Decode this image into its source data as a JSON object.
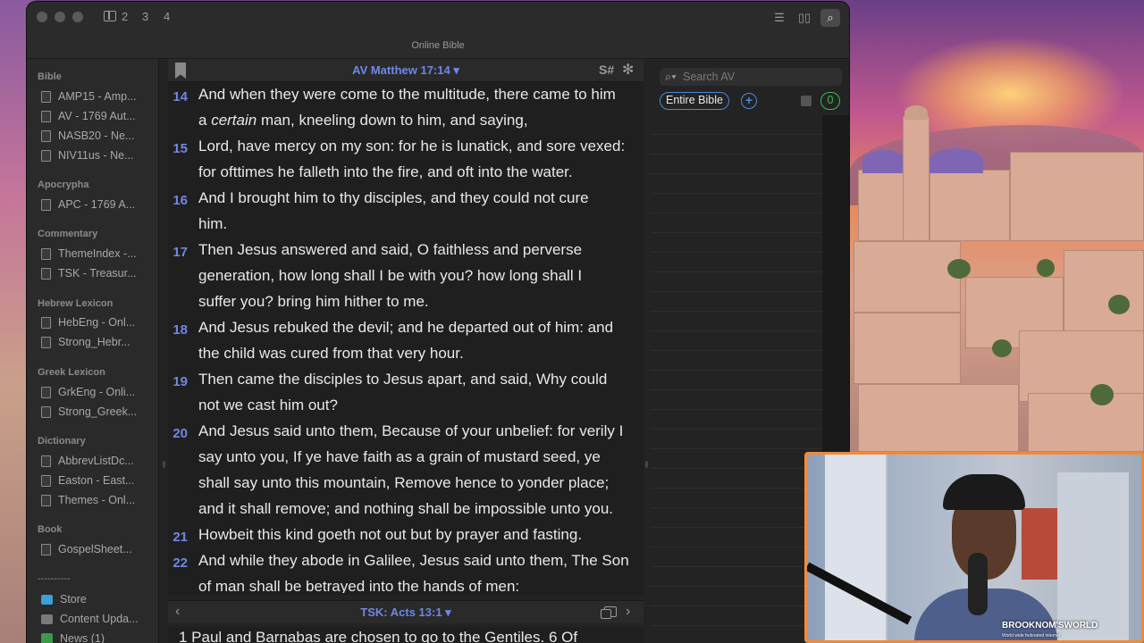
{
  "window": {
    "title": "Online Bible",
    "pane_numbers": [
      "2",
      "3",
      "4"
    ]
  },
  "sidebar": {
    "sections": [
      {
        "title": "Bible",
        "items": [
          "AMP15 - Amp...",
          "AV - 1769 Aut...",
          "NASB20 - Ne...",
          "NIV11us - Ne..."
        ]
      },
      {
        "title": "Apocrypha",
        "items": [
          "APC - 1769 A..."
        ]
      },
      {
        "title": "Commentary",
        "items": [
          "ThemeIndex -...",
          "TSK - Treasur..."
        ]
      },
      {
        "title": "Hebrew Lexicon",
        "items": [
          "HebEng - Onl...",
          "Strong_Hebr..."
        ]
      },
      {
        "title": "Greek Lexicon",
        "items": [
          "GrkEng - Onli...",
          "Strong_Greek..."
        ]
      },
      {
        "title": "Dictionary",
        "items": [
          "AbbrevListDc...",
          "Easton - East...",
          "Themes - Onl..."
        ]
      },
      {
        "title": "Book",
        "items": [
          "GospelSheet..."
        ]
      }
    ],
    "separator": "----------",
    "footer_items": [
      "Store",
      "Content Upda...",
      "News (1)"
    ]
  },
  "main": {
    "reference": "AV  Matthew 17:14  ▾",
    "verses": [
      {
        "num": "14",
        "lines": [
          "And when they were come to the multitude, there came to him",
          "a <i>certain</i> man, kneeling down to him, and saying,"
        ]
      },
      {
        "num": "15",
        "lines": [
          "Lord, have mercy on my son: for he is lunatick, and sore vexed:",
          "for ofttimes he falleth into the fire, and oft into the water."
        ]
      },
      {
        "num": "16",
        "lines": [
          "And I brought him to thy disciples, and they could not cure",
          "him."
        ]
      },
      {
        "num": "17",
        "lines": [
          "Then Jesus answered and said, O faithless and perverse",
          "generation, how long shall I be with you? how long shall I",
          "suffer you? bring him hither to me."
        ]
      },
      {
        "num": "18",
        "lines": [
          "And Jesus rebuked the devil; and he departed out of him: and",
          "the child was cured from that very hour."
        ]
      },
      {
        "num": "19",
        "lines": [
          "Then came the disciples to Jesus apart, and said, Why could",
          "not we cast him out?"
        ]
      },
      {
        "num": "20",
        "lines": [
          "And Jesus said unto them, Because of your unbelief: for verily I",
          "say unto you, If ye have faith as a grain of mustard seed, ye",
          "shall say unto this mountain, Remove hence to yonder place;",
          "and it shall remove; and nothing shall be impossible unto you."
        ]
      },
      {
        "num": "21",
        "lines": [
          "Howbeit this kind goeth not out but by prayer and fasting."
        ]
      },
      {
        "num": "22",
        "lines": [
          "And while they abode in Galilee, Jesus said unto them, The Son",
          "of man shall be betrayed into the hands of men:"
        ]
      }
    ]
  },
  "bottom_pane": {
    "reference": "TSK: Acts 13:1  ▾",
    "text": "1  Paul and Barnabas are chosen to go to the Gentiles. 6  Of"
  },
  "search": {
    "placeholder": "Search AV",
    "scope": "Entire Bible",
    "add_label": "+",
    "count": "0"
  },
  "webcam": {
    "logo": "BROOKNOM'SWORLD",
    "logo_sub": "World wide federated internet"
  },
  "colors": {
    "accent_blue": "#6e88e6",
    "badge_green": "#3bbf4a",
    "webcam_border": "#f08a3a"
  }
}
